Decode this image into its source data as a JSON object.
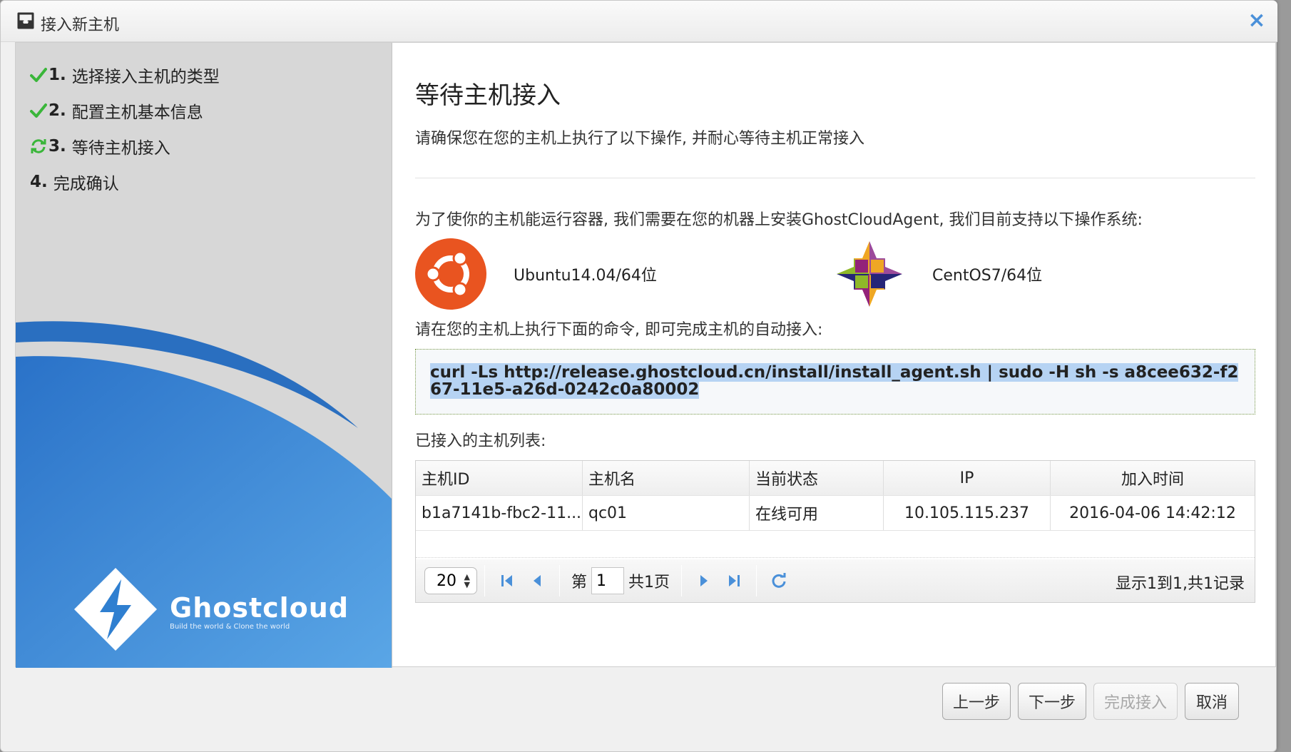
{
  "dialog": {
    "title": "接入新主机",
    "close_label": "×"
  },
  "steps": [
    {
      "num": "1.",
      "label": "选择接入主机的类型",
      "status": "done"
    },
    {
      "num": "2.",
      "label": "配置主机基本信息",
      "status": "done"
    },
    {
      "num": "3.",
      "label": "等待主机接入",
      "status": "current"
    },
    {
      "num": "4.",
      "label": "完成确认",
      "status": "pending"
    }
  ],
  "brand": {
    "name": "Ghostcloud",
    "tagline": "Build the world & Clone the world"
  },
  "main": {
    "title": "等待主机接入",
    "subtitle": "请确保您在您的主机上执行了以下操作, 并耐心等待主机正常接入",
    "intro": "为了使你的主机能运行容器, 我们需要在您的机器上安装GhostCloudAgent, 我们目前支持以下操作系统:",
    "os": [
      {
        "name": "Ubuntu14.04/64位",
        "icon": "ubuntu-logo"
      },
      {
        "name": "CentOS7/64位",
        "icon": "centos-logo"
      }
    ],
    "command_hint": "请在您的主机上执行下面的命令, 即可完成主机的自动接入:",
    "command": "curl -Ls http://release.ghostcloud.cn/install/install_agent.sh | sudo -H sh -s a8cee632-f267-11e5-a26d-0242c0a80002",
    "list_title": "已接入的主机列表:"
  },
  "table": {
    "columns": [
      "主机ID",
      "主机名",
      "当前状态",
      "IP",
      "加入时间"
    ],
    "rows": [
      [
        "b1a7141b-fbc2-11...",
        "qc01",
        "在线可用",
        "10.105.115.237",
        "2016-04-06 14:42:12"
      ]
    ]
  },
  "pager": {
    "page_size": "20",
    "page_prefix": "第",
    "page_value": "1",
    "page_total": "共1页",
    "info": "显示1到1,共1记录"
  },
  "buttons": {
    "prev": "上一步",
    "next": "下一步",
    "finish": "完成接入",
    "cancel": "取消"
  },
  "colors": {
    "accent": "#4a90d9",
    "check": "#3ab63a",
    "brand_blue": "#2f7fd0"
  }
}
